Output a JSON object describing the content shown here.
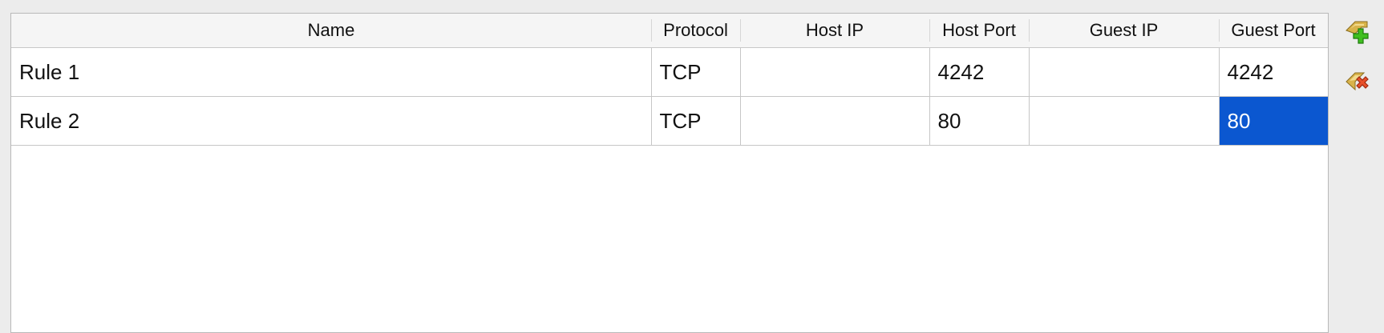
{
  "table": {
    "columns": [
      "Name",
      "Protocol",
      "Host IP",
      "Host Port",
      "Guest IP",
      "Guest Port"
    ],
    "rows": [
      {
        "name": "Rule 1",
        "protocol": "TCP",
        "host_ip": "",
        "host_port": "4242",
        "guest_ip": "",
        "guest_port": "4242"
      },
      {
        "name": "Rule 2",
        "protocol": "TCP",
        "host_ip": "",
        "host_port": "80",
        "guest_ip": "",
        "guest_port": "80"
      }
    ],
    "selected_cell": {
      "row": 2,
      "column": "Guest Port"
    }
  },
  "actions": {
    "add_icon": "add-rule-icon",
    "remove_icon": "remove-rule-icon"
  },
  "colors": {
    "selection": "#0b57d0",
    "add_accent": "#3fbf1f",
    "remove_accent": "#e8502a"
  }
}
